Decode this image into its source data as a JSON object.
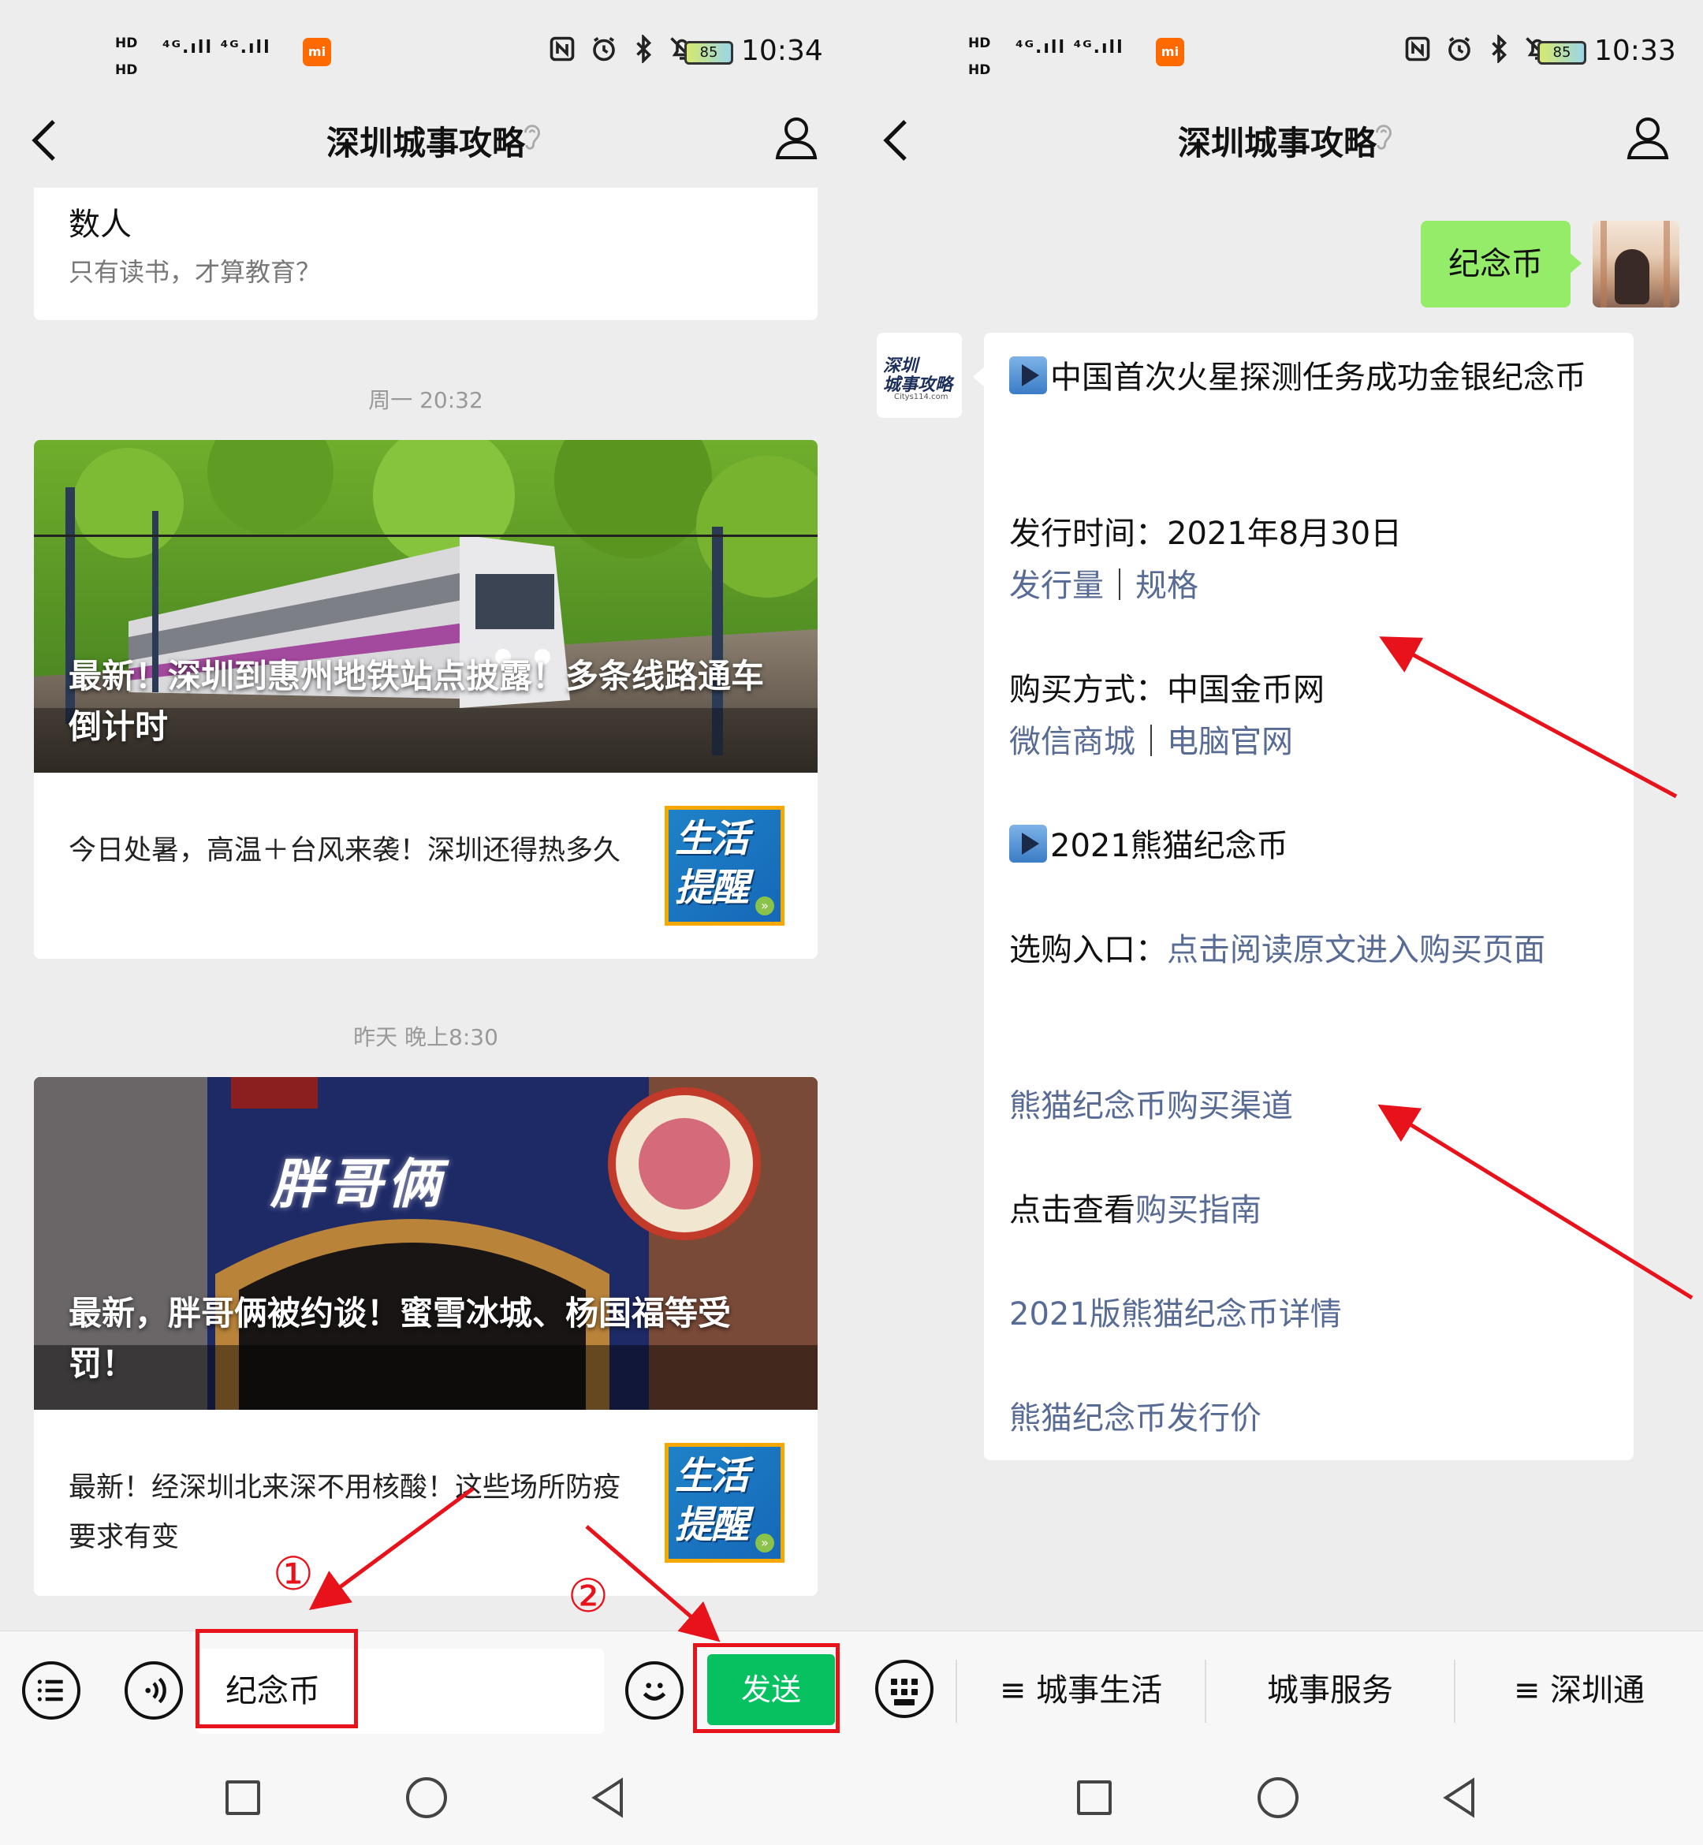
{
  "status_bar": {
    "left_panel": {
      "hd1": "HD",
      "hd2": "HD",
      "network": "⁴ᴳ.ıll ⁴ᴳ.ıll",
      "battery": "85",
      "time": "10:34"
    },
    "right_panel": {
      "hd1": "HD",
      "hd2": "HD",
      "network": "⁴ᴳ.ıll ⁴ᴳ.ıll",
      "battery": "85",
      "time": "10:33"
    },
    "mi_label": "mi"
  },
  "header": {
    "title": "深圳城事攻略"
  },
  "left_chat": {
    "top_card": {
      "title": "数人",
      "subtitle": "只有读书，才算教育？"
    },
    "timestamp1": "周一 20:32",
    "article1": {
      "hero_title": "最新！深圳到惠州地铁站点披露！多条线路通车倒计时",
      "sub_title": "今日处暑，高温＋台风来袭！深圳还得热多久",
      "thumb_text": "生活提醒"
    },
    "timestamp2": "昨天 晚上8:30",
    "article2": {
      "hero_title": "最新，胖哥俩被约谈！蜜雪冰城、杨国福等受罚！",
      "sign_text": "胖哥俩",
      "sub_title": "最新！经深圳北来深不用核酸！这些场所防疫要求有变",
      "thumb_text": "生活提醒"
    }
  },
  "input_bar": {
    "value": "纪念币",
    "send_label": "发送"
  },
  "annotations": {
    "step1": "①",
    "step2": "②"
  },
  "right_chat": {
    "my_message": "纪念币",
    "bot_avatar": {
      "line1": "深圳",
      "line2": "城事攻略",
      "line3": "Citys114.com"
    },
    "reply": {
      "item1_title": "中国首次火星探测任务成功金银纪念币",
      "issue_time": "发行时间：2021年8月30日",
      "issue_link_a": "发行量",
      "issue_sep": "｜",
      "issue_link_b": "规格",
      "buy_method": "购买方式：中国金币网",
      "buy_link_a": "微信商城",
      "buy_sep": "｜",
      "buy_link_b": "电脑官网",
      "item2_title": "2021熊猫纪念币",
      "entry_label": "选购入口：",
      "entry_link": "点击阅读原文进入购买页面",
      "link_channels": "熊猫纪念币购买渠道",
      "guide_prefix": "点击查看",
      "guide_link": "购买指南",
      "link_details": "2021版熊猫纪念币详情",
      "link_price": "熊猫纪念币发行价"
    }
  },
  "menu_bar": {
    "item1": "≡ 城事生活",
    "item2": "城事服务",
    "item3": "≡ 深圳通"
  },
  "colors": {
    "wechat_green": "#07c160",
    "bubble_green": "#95ec69",
    "link_blue": "#576b95",
    "annotation_red": "#e8121b"
  },
  "icons": [
    "back-icon",
    "ear-icon",
    "user-icon",
    "list-icon",
    "voice-icon",
    "emoji-icon",
    "keyboard-icon",
    "play-icon"
  ]
}
